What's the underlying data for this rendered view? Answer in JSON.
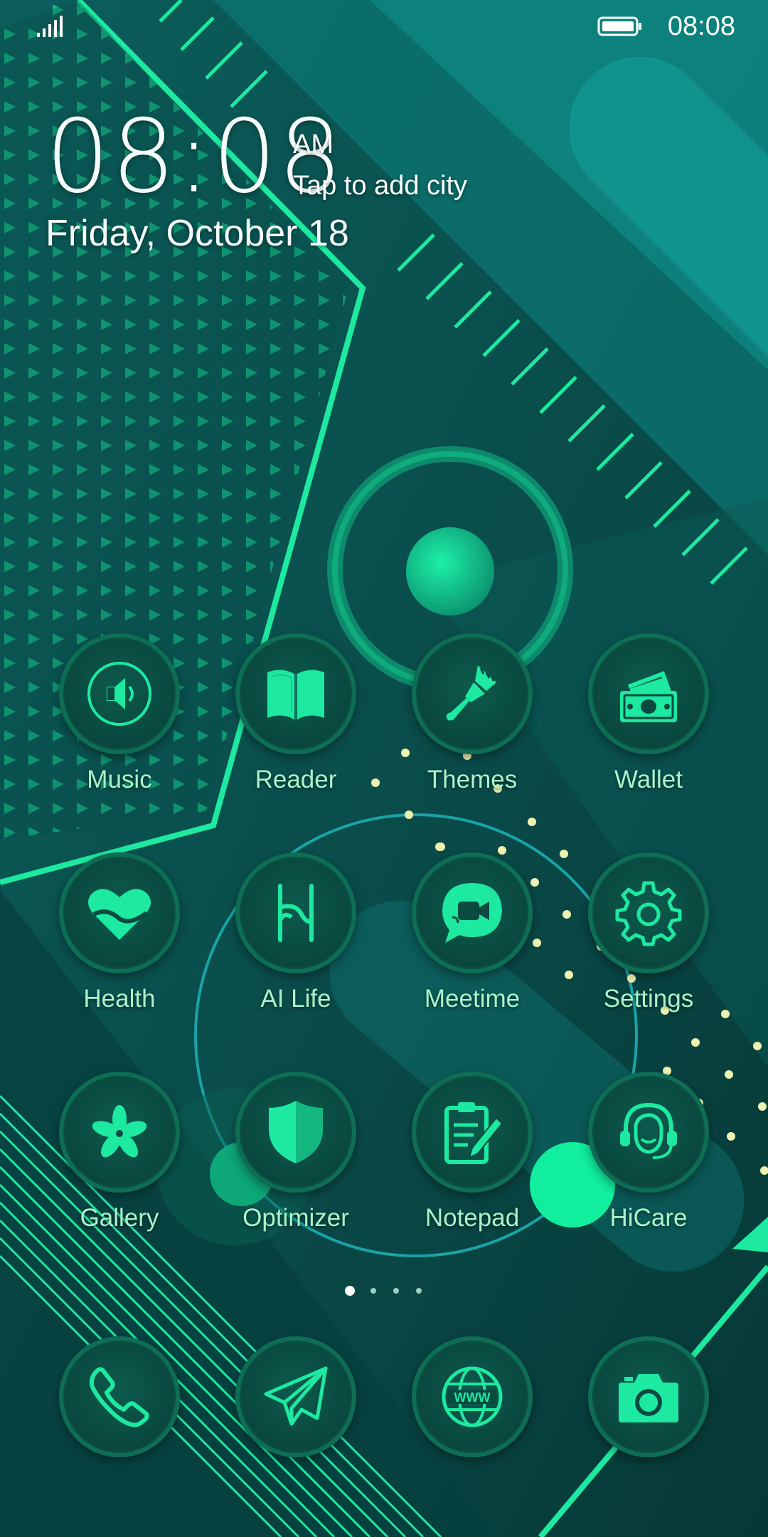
{
  "status_bar": {
    "time": "08:08",
    "signal_icon": "signal-icon",
    "battery_icon": "battery-icon"
  },
  "clock_widget": {
    "time": "08:08",
    "ampm": "AM",
    "city_prompt": "Tap to add city",
    "date": "Friday, October 18"
  },
  "apps": [
    {
      "label": "Music",
      "icon": "music-speaker-icon"
    },
    {
      "label": "Reader",
      "icon": "book-icon"
    },
    {
      "label": "Themes",
      "icon": "paintbrush-icon"
    },
    {
      "label": "Wallet",
      "icon": "wallet-icon"
    },
    {
      "label": "Health",
      "icon": "heart-icon"
    },
    {
      "label": "AI Life",
      "icon": "ai-life-icon"
    },
    {
      "label": "Meetime",
      "icon": "video-chat-icon"
    },
    {
      "label": "Settings",
      "icon": "gear-icon"
    },
    {
      "label": "Gallery",
      "icon": "flower-icon"
    },
    {
      "label": "Optimizer",
      "icon": "shield-icon"
    },
    {
      "label": "Notepad",
      "icon": "notepad-icon"
    },
    {
      "label": "HiCare",
      "icon": "headset-icon"
    }
  ],
  "page_indicator": {
    "pages": 4,
    "current": 1
  },
  "dock": [
    {
      "icon": "phone-icon"
    },
    {
      "icon": "paper-plane-icon"
    },
    {
      "icon": "globe-www-icon"
    },
    {
      "icon": "camera-icon"
    }
  ],
  "colors": {
    "accent_green": "#1de9a0",
    "label_green": "#a9f3c9",
    "background_teal": "#07403f"
  }
}
